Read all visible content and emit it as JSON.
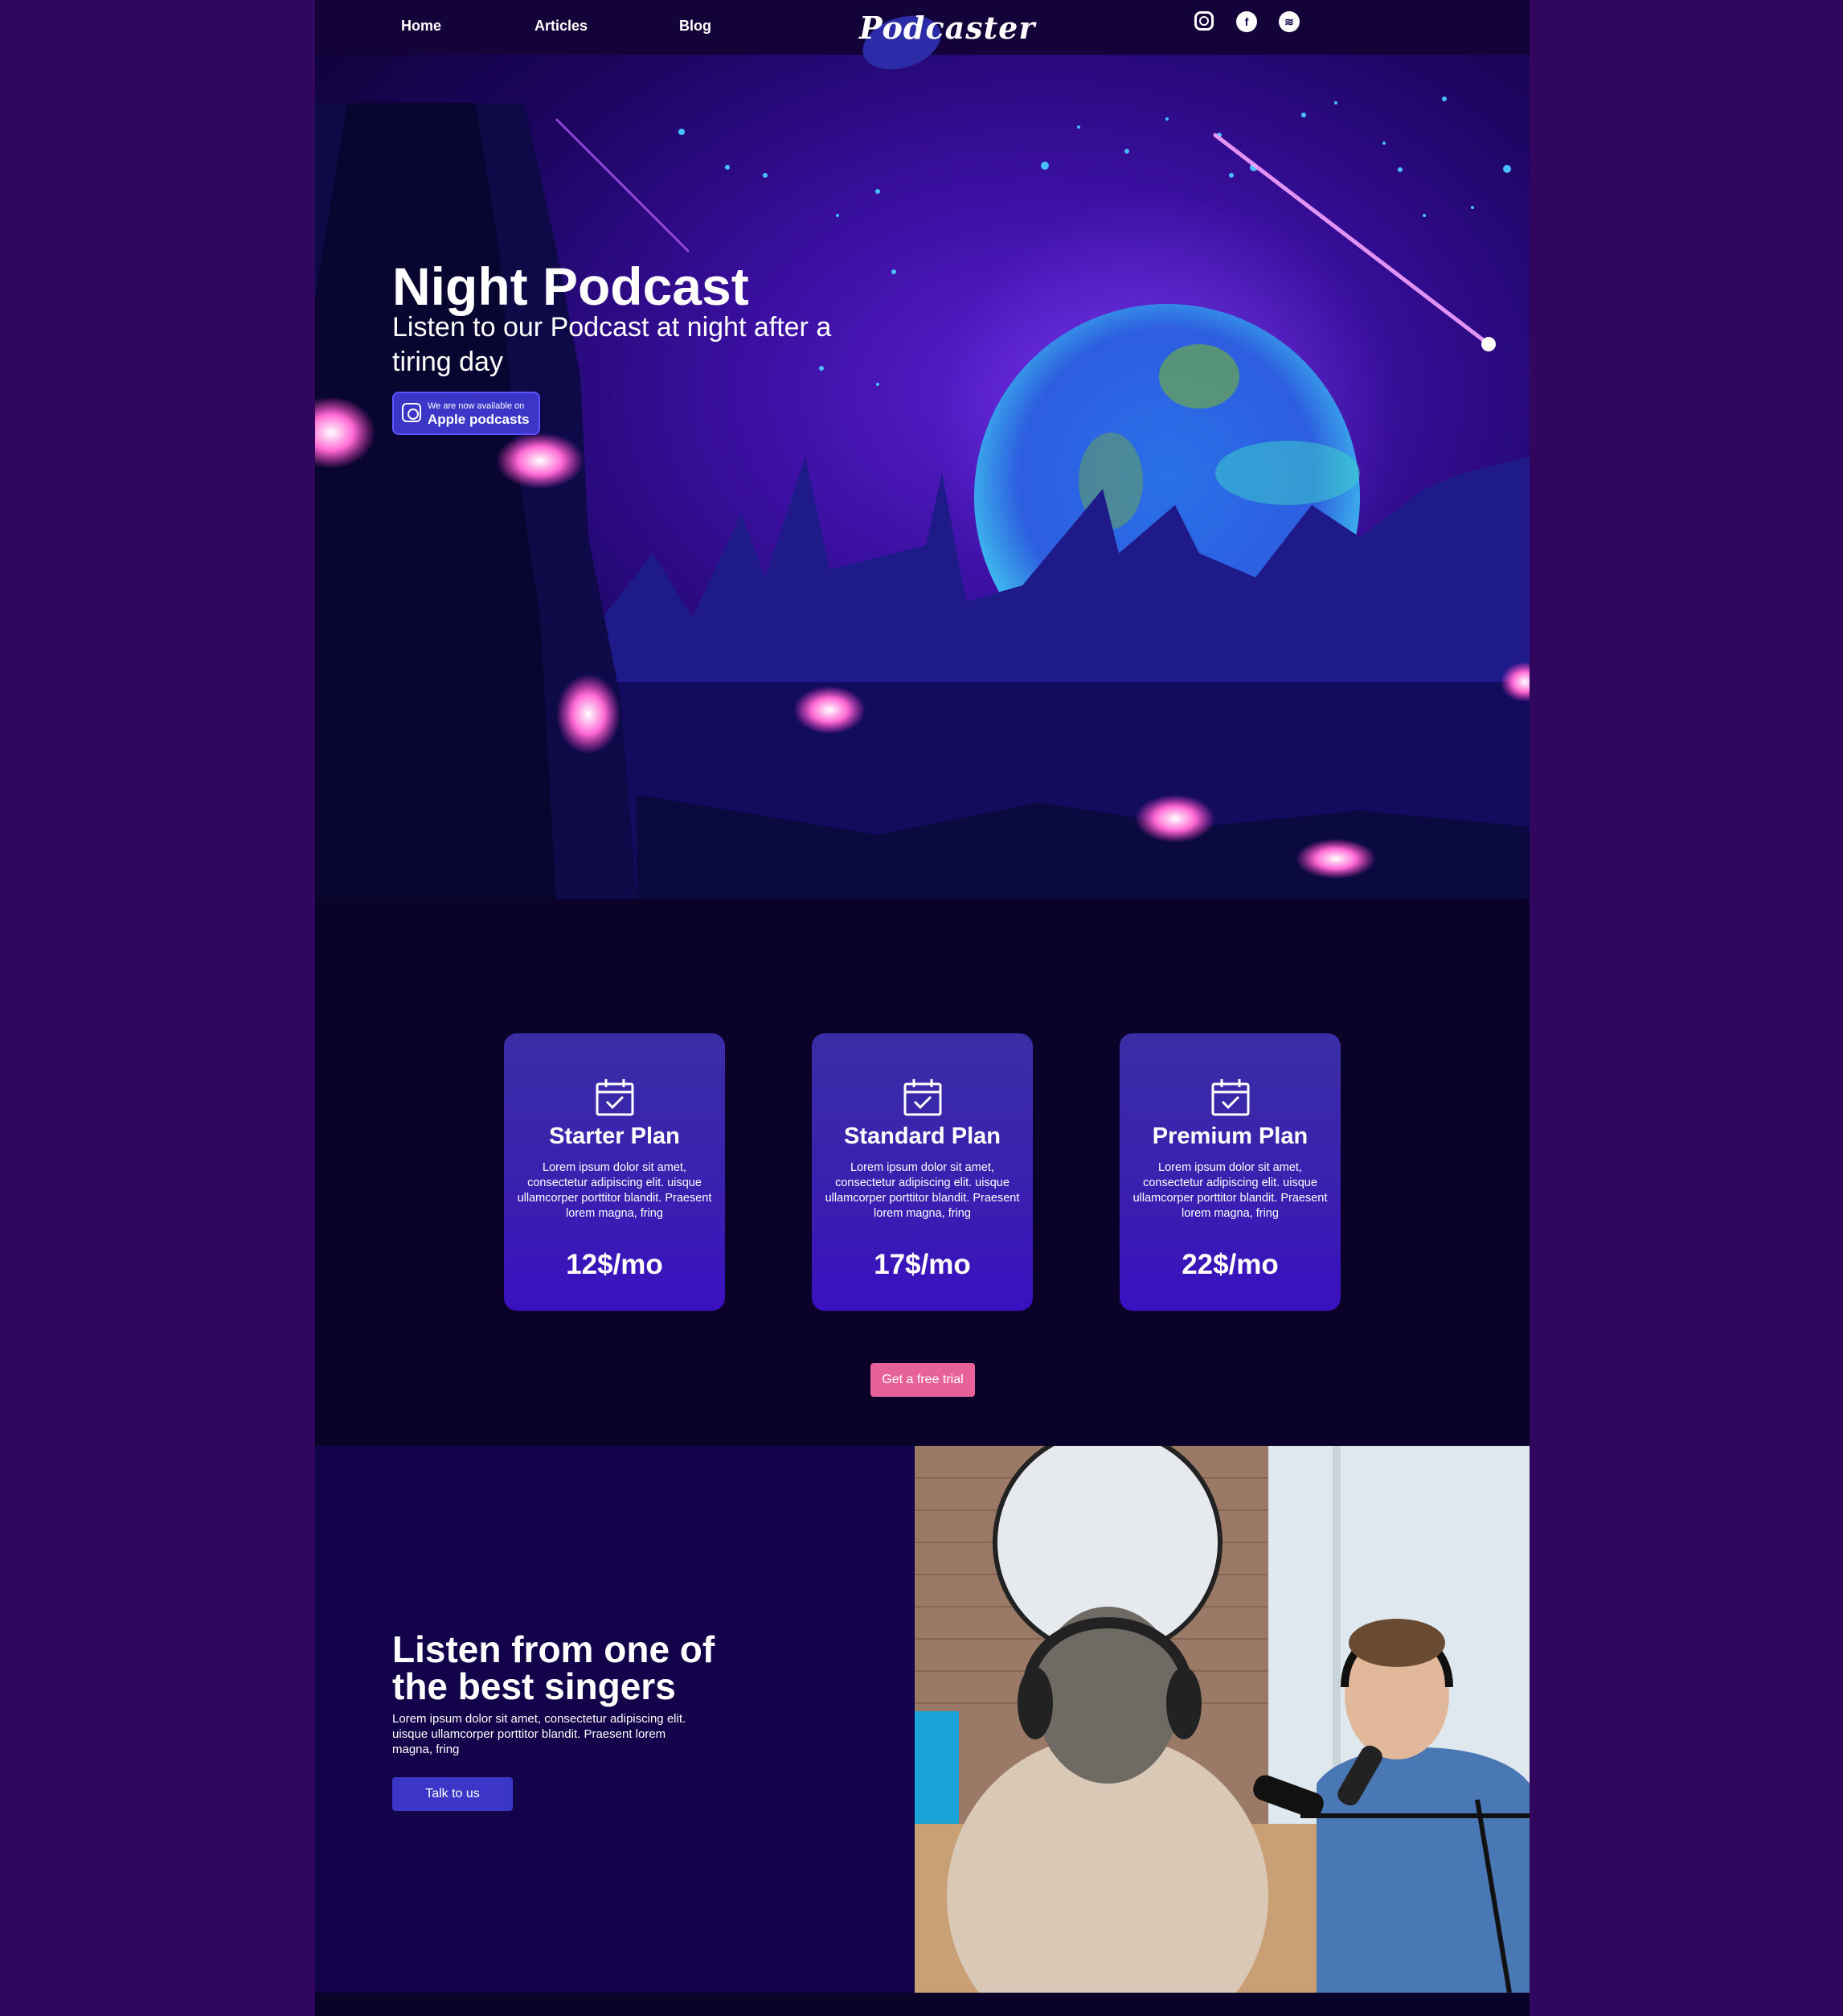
{
  "nav": {
    "links": [
      "Home",
      "Articles",
      "Blog"
    ],
    "logo": "Podcaster",
    "social": [
      "instagram-icon",
      "facebook-icon",
      "spotify-icon"
    ]
  },
  "hero": {
    "title": "Night Podcast",
    "subtitle": "Listen to our Podcast at night after a tiring day",
    "badge_small": "We are now available on",
    "badge_big": "Apple podcasts"
  },
  "plans": [
    {
      "name": "Starter Plan",
      "desc": "Lorem ipsum dolor sit amet, consectetur adipiscing elit. uisque ullamcorper porttitor blandit. Praesent lorem magna, fring",
      "price": "12$/mo"
    },
    {
      "name": "Standard Plan",
      "desc": "Lorem ipsum dolor sit amet, consectetur adipiscing elit. uisque ullamcorper porttitor blandit. Praesent lorem magna, fring",
      "price": "17$/mo"
    },
    {
      "name": "Premium Plan",
      "desc": "Lorem ipsum dolor sit amet, consectetur adipiscing elit. uisque ullamcorper porttitor blandit. Praesent lorem magna, fring",
      "price": "22$/mo"
    }
  ],
  "trial_button": "Get a free trial",
  "singers": {
    "title": "Listen from one of the best singers",
    "desc": "Lorem ipsum dolor sit amet, consectetur adipiscing elit. uisque ullamcorper porttitor blandit. Praesent lorem magna, fring",
    "button": "Talk to us"
  },
  "colors": {
    "outer_bg": "#30065f",
    "page_bg": "#0a0228",
    "accent_pink": "#e8629a",
    "accent_blue": "#3b36c8"
  }
}
